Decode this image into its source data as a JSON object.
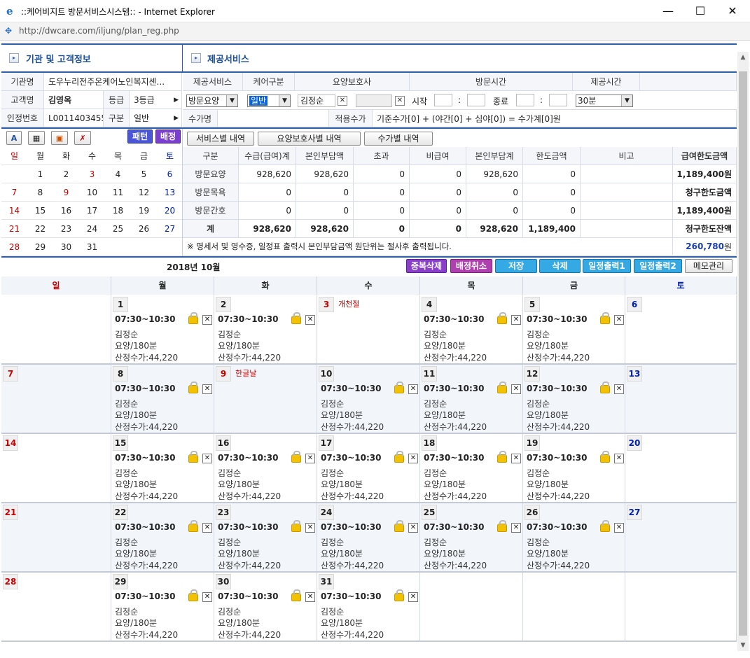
{
  "window": {
    "title": "::케어비지트 방문서비스시스템:: - Internet Explorer",
    "url": "http://dwcare.com/iljung/plan_reg.php",
    "minimize": "—",
    "maximize": "☐",
    "close": "✕"
  },
  "client": {
    "section_title": "기관 및 고객정보",
    "agency_label": "기관명",
    "agency_value": "도우누리전주온케어노인복지센...",
    "name_label": "고객명",
    "name_value": "김영옥",
    "grade_label": "등급",
    "grade_value": "3등급",
    "cert_label": "인정번호",
    "cert_value": "L0011403455",
    "type_label": "구분",
    "type_value": "일반"
  },
  "service": {
    "section_title": "제공서비스",
    "col_service": "제공서비스",
    "col_care": "케어구분",
    "col_caregiver": "요양보호사",
    "col_visit_time": "방문시간",
    "col_provide_time": "제공시간",
    "service_value": "방문요양",
    "care_value": "일반",
    "caregiver_value": "김정순",
    "start_label": "시작",
    "end_label": "종료",
    "colon": ":",
    "provide_value": "30분",
    "fee_name_label": "수가명",
    "applied_fee_label": "적용수가",
    "fee_formula": "기준수가[0] + (야간[0] + 심야[0]) = 수가계[0]원"
  },
  "mini_calendar": {
    "pattern_button": "패턴",
    "assign_button": "배정",
    "weekdays": [
      "일",
      "월",
      "화",
      "수",
      "목",
      "금",
      "토"
    ],
    "weeks": [
      [
        "",
        "1",
        "2",
        "3",
        "4",
        "5",
        "6"
      ],
      [
        "7",
        "8",
        "9",
        "10",
        "11",
        "12",
        "13"
      ],
      [
        "14",
        "15",
        "16",
        "17",
        "18",
        "19",
        "20"
      ],
      [
        "21",
        "22",
        "23",
        "24",
        "25",
        "26",
        "27"
      ],
      [
        "28",
        "29",
        "30",
        "31",
        "",
        "",
        ""
      ]
    ],
    "holidays": [
      "3",
      "9"
    ]
  },
  "summary": {
    "tab_service": "서비스별 내역",
    "tab_caregiver": "요양보호사별 내역",
    "tab_fee": "수가별 내역",
    "headers": [
      "구분",
      "수급(급여)계",
      "본인부담액",
      "초과",
      "비급여",
      "본인부담계",
      "한도금액",
      "비고",
      "급여한도금액"
    ],
    "rows": [
      {
        "name": "방문요양",
        "v": [
          "928,620",
          "928,620",
          "0",
          "0",
          "928,620",
          "0"
        ],
        "right": "1,189,400원"
      },
      {
        "name": "방문목욕",
        "v": [
          "0",
          "0",
          "0",
          "0",
          "0",
          "0"
        ],
        "right": "청구한도금액"
      },
      {
        "name": "방문간호",
        "v": [
          "0",
          "0",
          "0",
          "0",
          "0",
          "0"
        ],
        "right": "1,189,400원"
      },
      {
        "name": "계",
        "v": [
          "928,620",
          "928,620",
          "0",
          "0",
          "928,620",
          "1,189,400"
        ],
        "right": "청구한도잔액"
      }
    ],
    "note": "※ 명세서 및 영수증, 일정표 출력시 본인부담금액 원단위는 절사후 출력됩니다.",
    "balance": "260,780",
    "balance_unit": "원"
  },
  "toolbar": {
    "month_label": "2018년 10월",
    "dup_delete": "중복삭제",
    "cancel_assign": "배정취소",
    "save": "저장",
    "delete": "삭제",
    "print1": "일정출력1",
    "print2": "일정출력2",
    "memo": "메모관리"
  },
  "calendar": {
    "weekdays": [
      "일",
      "월",
      "화",
      "수",
      "목",
      "금",
      "토"
    ],
    "weeks": [
      [
        "",
        "1",
        "2",
        "3",
        "4",
        "5",
        "6"
      ],
      [
        "7",
        "8",
        "9",
        "10",
        "11",
        "12",
        "13"
      ],
      [
        "14",
        "15",
        "16",
        "17",
        "18",
        "19",
        "20"
      ],
      [
        "21",
        "22",
        "23",
        "24",
        "25",
        "26",
        "27"
      ],
      [
        "28",
        "29",
        "30",
        "31",
        "",
        "",
        ""
      ]
    ],
    "holidays": {
      "3": "개천절",
      "9": "한글날"
    },
    "entry": {
      "time": "07:30~10:30",
      "caregiver": "김정순",
      "service": "요양/180분",
      "fee": "산정수가:44,220"
    }
  }
}
